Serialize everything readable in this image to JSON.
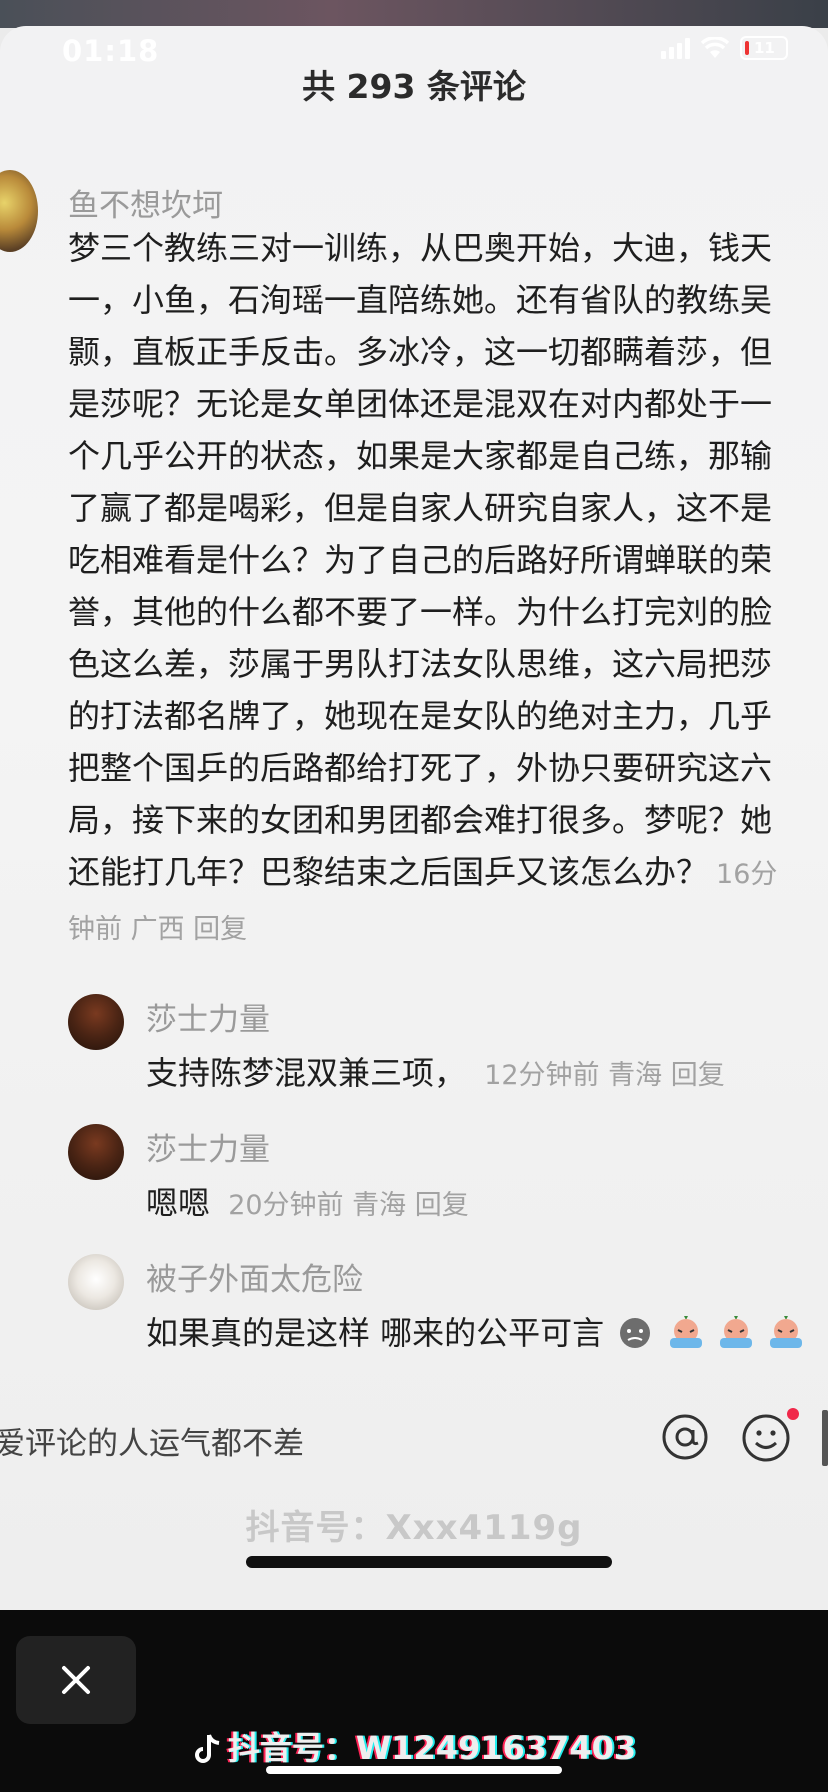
{
  "status": {
    "time": "01:18",
    "battery": "11"
  },
  "header": {
    "title": "共 293 条评论"
  },
  "main_comment": {
    "user": "鱼不想坎坷",
    "text": "梦三个教练三对一训练，从巴奥开始，大迪，钱天一，小鱼，石洵瑶一直陪练她。还有省队的教练吴颢，直板正手反击。多冰冷，这一切都瞒着莎，但是莎呢？无论是女单团体还是混双在对内都处于一个几乎公开的状态，如果是大家都是自己练，那输了赢了都是喝彩，但是自家人研究自家人，这不是吃相难看是什么？为了自己的后路好所谓蝉联的荣誉，其他的什么都不要了一样。为什么打完刘的脸色这么差，莎属于男队打法女队思维，这六局把莎的打法都名牌了，她现在是女队的绝对主力，几乎把整个国乒的后路都给打死了，外协只要研究这六局，接下来的女团和男团都会难打很多。梦呢？她还能打几年？巴黎结束之后国乒又该怎么办？",
    "meta": "16分钟前 广西 回复"
  },
  "replies": [
    {
      "user": "莎士力量",
      "text": "支持陈梦混双兼三项，",
      "meta": "12分钟前 青海 回复"
    },
    {
      "user": "莎士力量",
      "text": "嗯嗯",
      "meta": "20分钟前 青海 回复"
    },
    {
      "user": "被子外面太危险",
      "text": "如果真的是这样 哪来的公平可言",
      "meta": ""
    }
  ],
  "input": {
    "placeholder": "爱评论的人运气都不差"
  },
  "watermark": "抖音号：Xxx4119g",
  "footer": {
    "text": "抖音号：W12491637403"
  },
  "colors": {
    "accent_red": "#f0284a",
    "text_dark": "#1e1e1e",
    "text_gray": "#9a9a9a"
  }
}
